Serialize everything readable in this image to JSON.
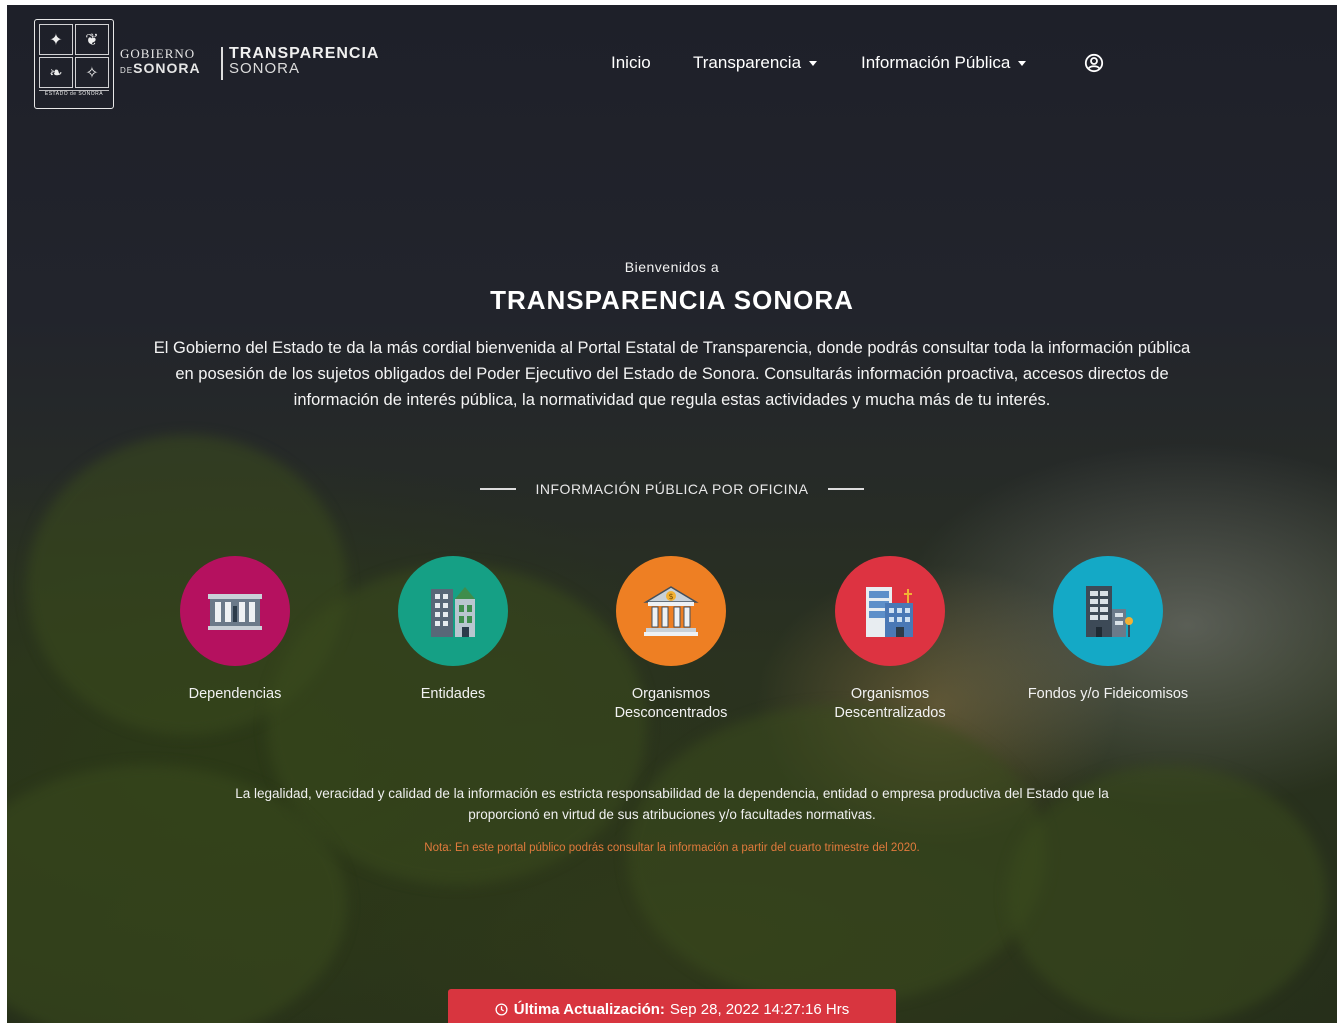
{
  "header": {
    "seal_caption": "ESTADO de SONORA",
    "gobierno_line1": "GOBIERNO",
    "gobierno_de": "DE",
    "gobierno_line2": "SONORA",
    "brand_line1": "TRANSPARENCIA",
    "brand_line2": "SONORA"
  },
  "nav": {
    "inicio": "Inicio",
    "transparencia": "Transparencia",
    "informacion_publica": "Información Pública",
    "user_icon": "user-circle-icon"
  },
  "hero": {
    "welcome": "Bienvenidos a",
    "title": "TRANSPARENCIA SONORA",
    "intro": "El Gobierno del Estado te da la más cordial bienvenida al Portal Estatal de Transparencia, donde podrás consultar toda la información pública en posesión de los sujetos obligados del Poder Ejecutivo del Estado de Sonora. Consultarás información proactiva, accesos directos de información de interés pública, la normatividad que regula estas actividades y mucha más de tu interés."
  },
  "section": {
    "heading": "INFORMACIÓN PÚBLICA POR OFICINA"
  },
  "offices": [
    {
      "label": "Dependencias",
      "color": "#b5115f",
      "icon": "government-building-icon"
    },
    {
      "label": "Entidades",
      "color": "#15a085",
      "icon": "office-buildings-icon"
    },
    {
      "label": "Organismos Desconcentrados",
      "color": "#ee7f23",
      "icon": "bank-building-icon"
    },
    {
      "label": "Organismos Descentralizados",
      "color": "#dd3341",
      "icon": "city-buildings-icon"
    },
    {
      "label": "Fondos y/o Fideicomisos",
      "color": "#14a9c6",
      "icon": "office-tower-icon"
    }
  ],
  "legal": "La legalidad, veracidad y calidad de la información es estricta responsabilidad de la dependencia, entidad o empresa productiva del Estado que la proporcionó en virtud de sus atribuciones y/o facultades normativas.",
  "note": "Nota: En este portal público podrás consultar la información a partir del cuarto trimestre del 2020.",
  "update": {
    "label": "Última Actualización:",
    "value": "Sep 28, 2022 14:27:16 Hrs",
    "color": "#d8353f"
  }
}
